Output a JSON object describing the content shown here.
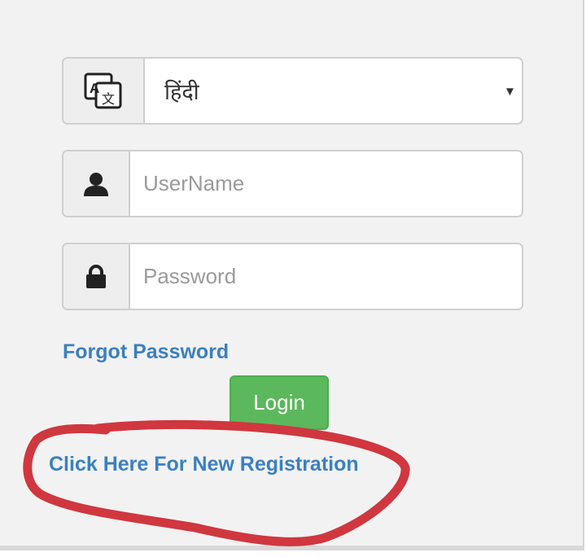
{
  "language_select": {
    "selected": "हिंदी",
    "icon": "translate-icon",
    "caret": "▾"
  },
  "username": {
    "placeholder": "UserName",
    "value": "",
    "icon": "user-icon"
  },
  "password": {
    "placeholder": "Password",
    "value": "",
    "icon": "lock-icon"
  },
  "forgot_password_label": "Forgot Password",
  "login_label": "Login",
  "register_label": "Click Here For New Registration",
  "colors": {
    "link": "#3a80c1",
    "button": "#5cb85c",
    "annotation": "#d0373f"
  }
}
